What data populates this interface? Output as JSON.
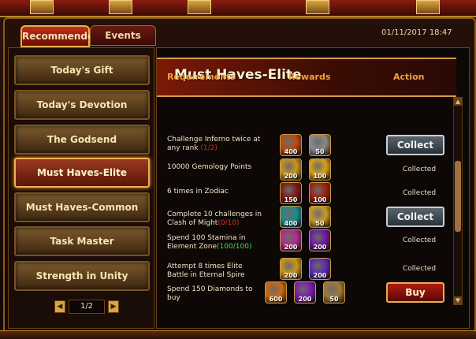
{
  "tabs": [
    {
      "label": "Recommended",
      "active": true
    },
    {
      "label": "Events",
      "active": false
    }
  ],
  "datetime": "01/11/2017 18:47",
  "sidebar": {
    "items": [
      {
        "label": "Today's Gift"
      },
      {
        "label": "Today's Devotion"
      },
      {
        "label": "The Godsend"
      },
      {
        "label": "Must Haves-Elite",
        "active": true
      },
      {
        "label": "Must Haves-Common"
      },
      {
        "label": "Task Master"
      },
      {
        "label": "Strength in Unity"
      }
    ],
    "pager": "1/2"
  },
  "main": {
    "title": "Must Haves-Elite",
    "headers": {
      "requirements": "Requirements",
      "rewards": "Rewards",
      "action": "Action"
    },
    "rows": [
      {
        "req": "Challenge Inferno twice at any rank ",
        "progress": "(1/2)",
        "progress_state": "incomplete",
        "rewards": [
          {
            "icon": "fire-orb-icon",
            "qty": "400",
            "color": "#b84a10"
          },
          {
            "icon": "silver-coin-icon",
            "qty": "50",
            "color": "#8a8a8a"
          }
        ],
        "action": {
          "type": "button",
          "label": "Collect"
        }
      },
      {
        "req": "10000 Gemology Points",
        "progress": "",
        "progress_state": "",
        "rewards": [
          {
            "icon": "gold-ingot-icon",
            "qty": "200",
            "color": "#c8961c"
          },
          {
            "icon": "gold-coin-icon",
            "qty": "100",
            "color": "#d6a21a"
          }
        ],
        "action": {
          "type": "text",
          "label": "Collected"
        }
      },
      {
        "req": "6 times in Zodiac",
        "progress": "",
        "progress_state": "",
        "rewards": [
          {
            "icon": "crossed-swords-icon",
            "qty": "150",
            "color": "#7a1a18"
          },
          {
            "icon": "red-gem-icon",
            "qty": "100",
            "color": "#9a2214"
          }
        ],
        "action": {
          "type": "text",
          "label": "Collected"
        }
      },
      {
        "req": "Complete 10 challenges in Clash of Might",
        "progress": "(0/10)",
        "progress_state": "incomplete",
        "rewards": [
          {
            "icon": "cyan-crystal-icon",
            "qty": "400",
            "color": "#1c8a90"
          },
          {
            "icon": "gold-wings-icon",
            "qty": "50",
            "color": "#c89a2a"
          }
        ],
        "action": {
          "type": "button",
          "label": "Collect"
        }
      },
      {
        "req": "Spend 100 Stamina in Element Zone",
        "progress": "(100/100)",
        "progress_state": "complete",
        "rewards": [
          {
            "icon": "pink-crystal-icon",
            "qty": "200",
            "color": "#b02a8a"
          },
          {
            "icon": "purple-orb-icon",
            "qty": "200",
            "color": "#6a1aa0"
          }
        ],
        "action": {
          "type": "text",
          "label": "Collected"
        }
      },
      {
        "req": "Attempt 8 times Elite Battle in Eternal Spire",
        "progress": "",
        "progress_state": "",
        "rewards": [
          {
            "icon": "gold-chest-icon",
            "qty": "200",
            "color": "#c8961c"
          },
          {
            "icon": "purple-crystal-icon",
            "qty": "200",
            "color": "#5a2ab0"
          }
        ],
        "action": {
          "type": "text",
          "label": "Collected"
        }
      },
      {
        "req": "Spend 150 Diamonds to buy",
        "progress": "",
        "progress_state": "",
        "rewards": [
          {
            "icon": "orange-orb-icon",
            "qty": "600",
            "color": "#c86a10"
          },
          {
            "icon": "purple-sphere-icon",
            "qty": "200",
            "color": "#7a1ab0"
          },
          {
            "icon": "bronze-coin-icon",
            "qty": "50",
            "color": "#a07a3a"
          }
        ],
        "action": {
          "type": "buy",
          "label": "Buy"
        }
      }
    ]
  }
}
